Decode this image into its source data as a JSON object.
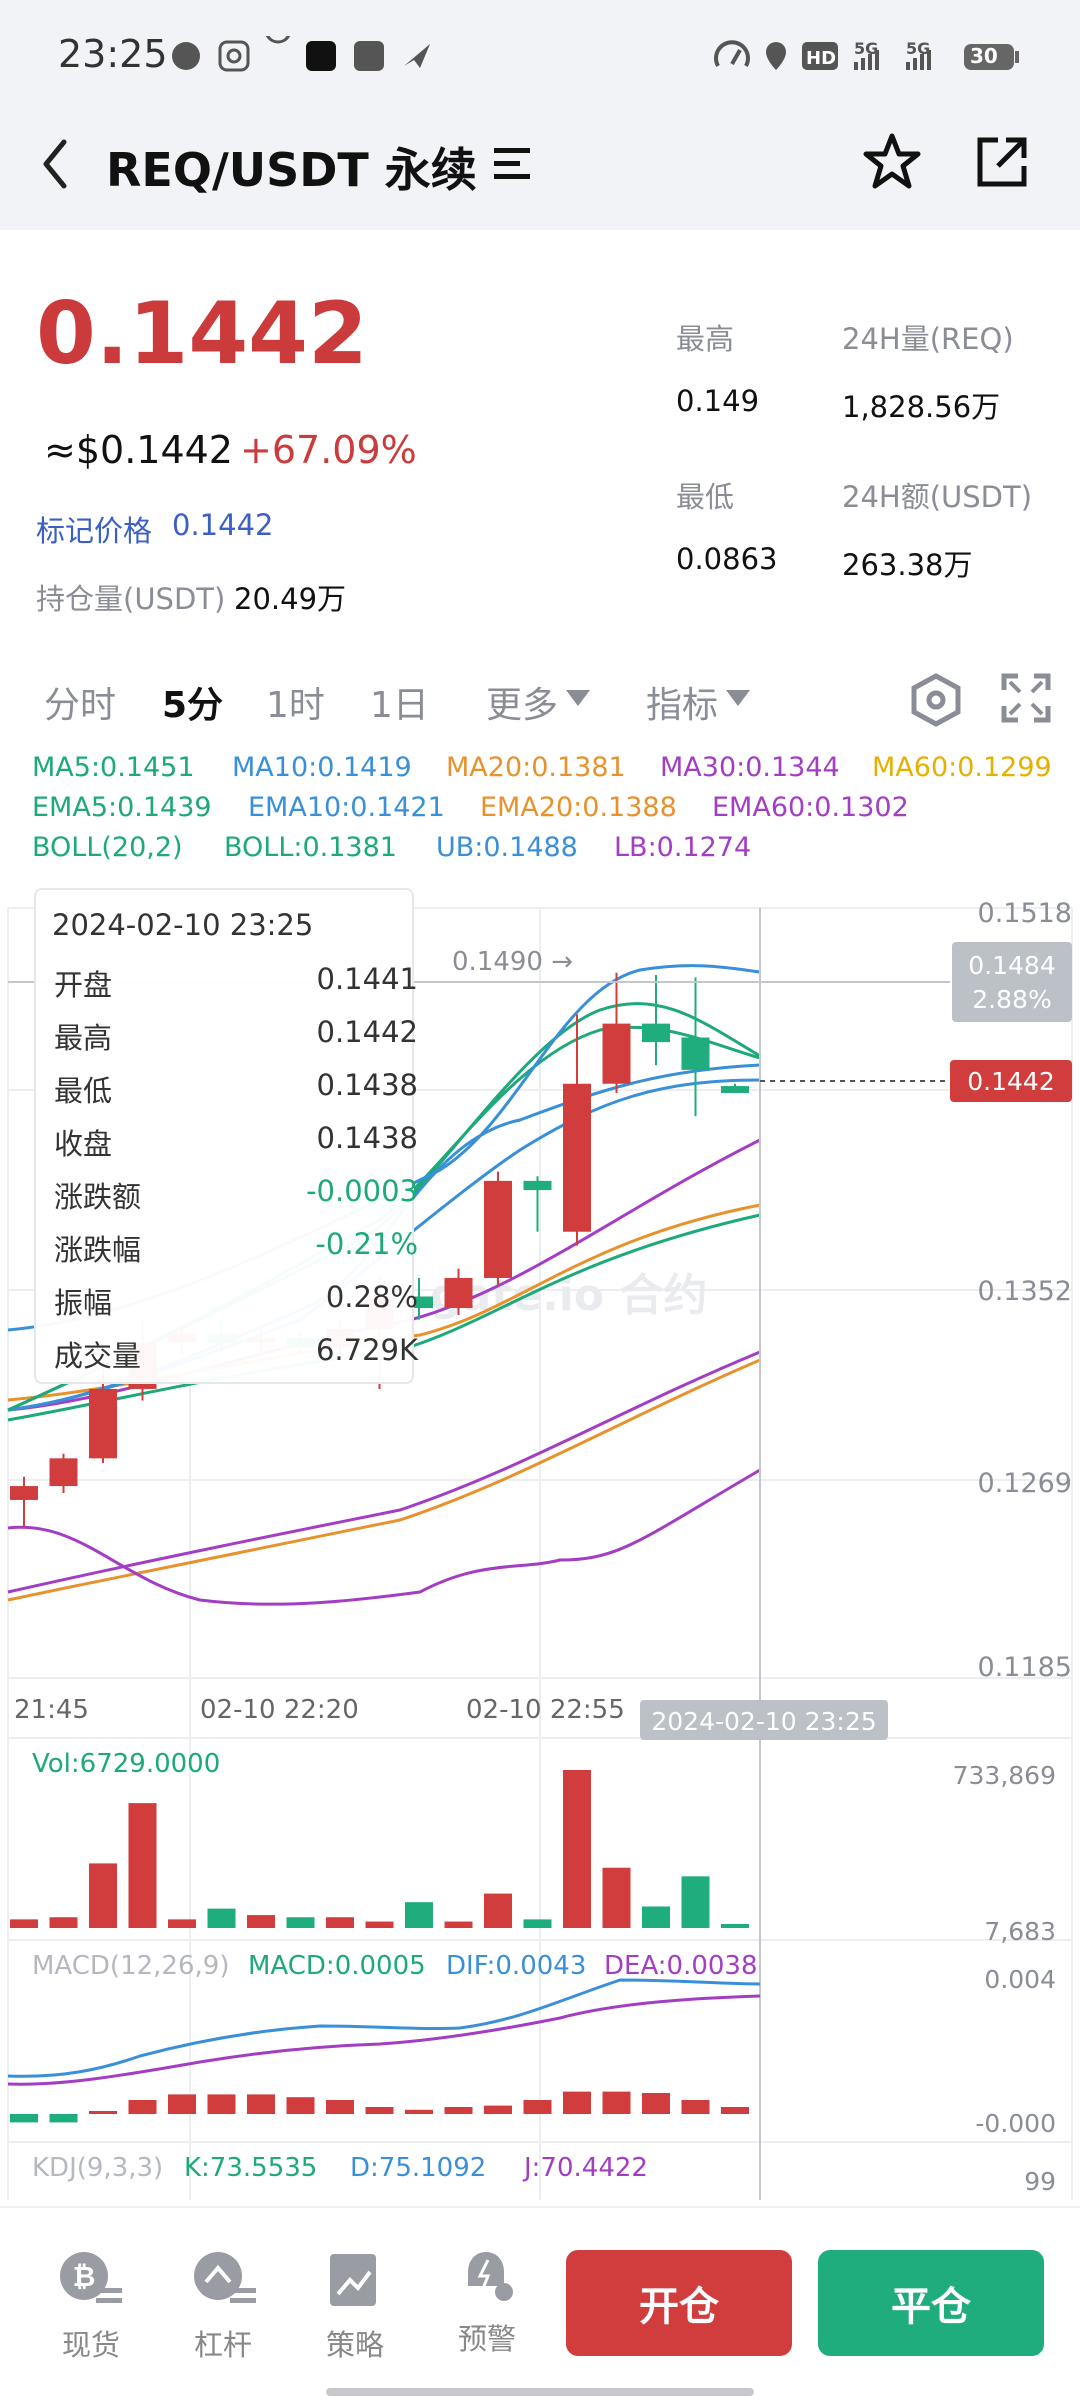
{
  "status_bar": {
    "time": "23:25",
    "network1": "5G",
    "network2": "5G",
    "battery": "30"
  },
  "header": {
    "pair": "REQ/USDT 永续"
  },
  "ticker": {
    "last_price": "0.1442",
    "usd_price": "≈$0.1442",
    "change_pct": "+67.09%",
    "mark_label": "标记价格",
    "mark_value": "0.1442",
    "oi_label": "持仓量(USDT)",
    "oi_value": "20.49万",
    "high_label": "最高",
    "high_value": "0.149",
    "low_label": "最低",
    "low_value": "0.0863",
    "vol_label": "24H量(REQ)",
    "vol_value": "1,828.56万",
    "amt_label": "24H额(USDT)",
    "amt_value": "263.38万"
  },
  "tabs": [
    "分时",
    "5分",
    "1时",
    "1日",
    "更多",
    "指标"
  ],
  "active_tab": "5分",
  "indicators": {
    "ma5": "MA5:0.1451",
    "ma10": "MA10:0.1419",
    "ma20": "MA20:0.1381",
    "ma30": "MA30:0.1344",
    "ma60": "MA60:0.1299",
    "ema5": "EMA5:0.1439",
    "ema10": "EMA10:0.1421",
    "ema20": "EMA20:0.1388",
    "ema60": "EMA60:0.1302",
    "boll": "BOLL(20,2)",
    "boll_mid": "BOLL:0.1381",
    "ub": "UB:0.1488",
    "lb": "LB:0.1274"
  },
  "tooltip": {
    "datetime": "2024-02-10 23:25",
    "rows": [
      {
        "label": "开盘",
        "value": "0.1441"
      },
      {
        "label": "最高",
        "value": "0.1442"
      },
      {
        "label": "最低",
        "value": "0.1438"
      },
      {
        "label": "收盘",
        "value": "0.1438"
      },
      {
        "label": "涨跌额",
        "value": "-0.0003"
      },
      {
        "label": "涨跌幅",
        "value": "-0.21%"
      },
      {
        "label": "振幅",
        "value": "0.28%"
      },
      {
        "label": "成交量",
        "value": "6.729K"
      }
    ]
  },
  "chart": {
    "y_ticks": [
      "0.1518",
      "0.1352",
      "0.1269",
      "0.1185"
    ],
    "crosshair_price": "0.1484",
    "crosshair_pct": "2.88%",
    "current_price_tag": "0.1442",
    "max_label": "0.1490 →",
    "x_ticks": [
      "21:45",
      "02-10 22:20",
      "02-10 22:55"
    ],
    "x_cursor": "2024-02-10 23:25",
    "watermark": "gate.io 合约"
  },
  "volume": {
    "label": "Vol:6729.0000",
    "max": "733,869",
    "min": "7,683"
  },
  "macd": {
    "label": "MACD(12,26,9)",
    "macd": "MACD:0.0005",
    "dif": "DIF:0.0043",
    "dea": "DEA:0.0038",
    "top": "0.004",
    "bottom": "-0.000"
  },
  "kdj": {
    "label": "KDJ(9,3,3)",
    "k": "K:73.5535",
    "d": "D:75.1092",
    "j": "J:70.4422",
    "top": "99"
  },
  "bottom_nav": {
    "spot": "现货",
    "leverage": "杠杆",
    "strategy": "策略",
    "alert": "预警",
    "open_btn": "开仓",
    "close_btn": "平仓"
  },
  "colors": {
    "up": "#d13d3d",
    "down": "#1fad7e",
    "price_red": "#cc3b3b"
  },
  "chart_data": {
    "type": "candlestick",
    "candles": [
      {
        "o": 0.1262,
        "h": 0.1272,
        "l": 0.125,
        "c": 0.1268
      },
      {
        "o": 0.1268,
        "h": 0.1282,
        "l": 0.1265,
        "c": 0.128
      },
      {
        "o": 0.128,
        "h": 0.1322,
        "l": 0.1278,
        "c": 0.131
      },
      {
        "o": 0.131,
        "h": 0.134,
        "l": 0.1305,
        "c": 0.133
      },
      {
        "o": 0.133,
        "h": 0.1338,
        "l": 0.1325,
        "c": 0.1334
      },
      {
        "o": 0.1334,
        "h": 0.134,
        "l": 0.1326,
        "c": 0.133
      },
      {
        "o": 0.133,
        "h": 0.1336,
        "l": 0.1326,
        "c": 0.1332
      },
      {
        "o": 0.1332,
        "h": 0.1335,
        "l": 0.1326,
        "c": 0.1328
      },
      {
        "o": 0.1328,
        "h": 0.134,
        "l": 0.1324,
        "c": 0.1336
      },
      {
        "o": 0.1336,
        "h": 0.1358,
        "l": 0.131,
        "c": 0.135
      },
      {
        "o": 0.135,
        "h": 0.1358,
        "l": 0.134,
        "c": 0.1345
      },
      {
        "o": 0.1345,
        "h": 0.1362,
        "l": 0.1342,
        "c": 0.1358
      },
      {
        "o": 0.1358,
        "h": 0.1404,
        "l": 0.1355,
        "c": 0.14
      },
      {
        "o": 0.14,
        "h": 0.1402,
        "l": 0.1378,
        "c": 0.1396
      },
      {
        "o": 0.1378,
        "h": 0.1472,
        "l": 0.1372,
        "c": 0.1442
      },
      {
        "o": 0.1442,
        "h": 0.149,
        "l": 0.1438,
        "c": 0.1468
      },
      {
        "o": 0.1468,
        "h": 0.1489,
        "l": 0.145,
        "c": 0.146
      },
      {
        "o": 0.1462,
        "h": 0.1488,
        "l": 0.1428,
        "c": 0.1448
      },
      {
        "o": 0.1441,
        "h": 0.1442,
        "l": 0.1438,
        "c": 0.1438
      }
    ],
    "volume": [
      40000,
      50000,
      300000,
      580000,
      40000,
      90000,
      60000,
      50000,
      50000,
      30000,
      120000,
      30000,
      160000,
      40000,
      733869,
      280000,
      100000,
      240000,
      6729
    ],
    "macd_hist": [
      -0.0006,
      -0.0006,
      0.0001,
      0.001,
      0.0014,
      0.0014,
      0.0014,
      0.0012,
      0.001,
      0.0005,
      0.0003,
      0.0005,
      0.0006,
      0.001,
      0.0016,
      0.0016,
      0.0015,
      0.001,
      0.0005
    ],
    "ylim": [
      0.1185,
      0.1518
    ]
  }
}
